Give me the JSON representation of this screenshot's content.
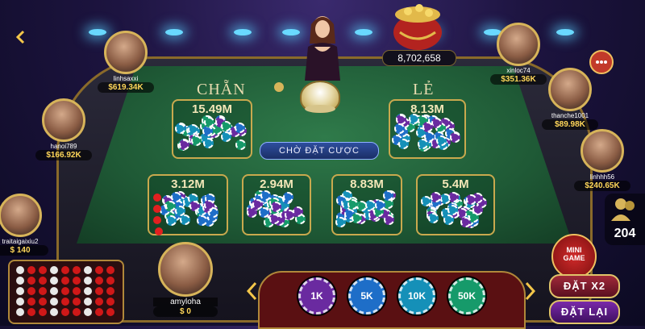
{
  "table": {
    "even_label": "CHẴN",
    "odd_label": "LẺ",
    "status": "CHỜ ĐẶT CƯỢC",
    "bets": [
      {
        "id": "even",
        "amount": "15.49M"
      },
      {
        "id": "odd",
        "amount": "8.13M"
      },
      {
        "id": "four-red",
        "amount": "3.12M"
      },
      {
        "id": "three-red",
        "amount": "2.94M"
      },
      {
        "id": "three-white",
        "amount": "8.83M"
      },
      {
        "id": "four-white",
        "amount": "5.4M"
      }
    ]
  },
  "jackpot": {
    "value": "8,702,658"
  },
  "players": [
    {
      "name": "linhsaxxi",
      "money": "$619.34K"
    },
    {
      "name": "hanoi789",
      "money": "$166.92K"
    },
    {
      "name": "traitaigaixiu2",
      "money": "$ 140"
    },
    {
      "name": "xinloc74",
      "money": "$351.36K"
    },
    {
      "name": "thanche1001",
      "money": "$89.98K"
    },
    {
      "name": "linhhh56",
      "money": "$240.65K"
    }
  ],
  "self": {
    "name": "amyloha",
    "money": "$ 0"
  },
  "online_count": "204",
  "chips": [
    "1K",
    "5K",
    "10K",
    "50K"
  ],
  "buttons": {
    "mini_game_top": "MINI",
    "mini_game_bottom": "GAME",
    "double": "ĐẶT X2",
    "rebet": "ĐẶT LẠI"
  },
  "colors": {
    "accent_gold": "#d7b45a",
    "felt": "#1f5a36",
    "double_btn": "#7a1a2a",
    "rebet_btn": "#5a1a8a"
  },
  "icons": [
    "back-icon",
    "chat-icon",
    "users-icon",
    "left-arrow-icon",
    "right-arrow-icon"
  ]
}
